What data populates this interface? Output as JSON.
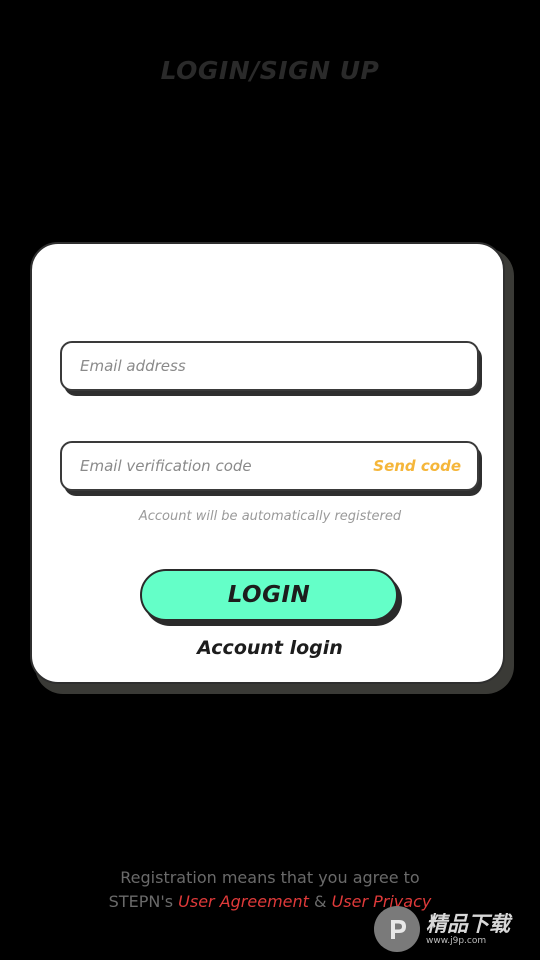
{
  "header": {
    "title": "LOGIN/SIGN UP"
  },
  "form": {
    "email": {
      "placeholder": "Email address",
      "value": ""
    },
    "code": {
      "placeholder": "Email verification code",
      "value": "",
      "send_label": "Send code"
    },
    "hint": "Account will be automatically registered",
    "login_label": "LOGIN",
    "account_login_label": "Account login"
  },
  "footer": {
    "line1": "Registration means that you agree to",
    "prefix": "STEPN's",
    "agreement_link": "User Agreement",
    "and": "&",
    "privacy_link": "User Privacy"
  },
  "watermark": {
    "name": "精品下载",
    "url": "www.j9p.com"
  },
  "colors": {
    "background": "#000000",
    "card": "#ffffff",
    "accent": "#64ffc8",
    "send_code": "#f5b63a",
    "link": "#e03a3a"
  }
}
